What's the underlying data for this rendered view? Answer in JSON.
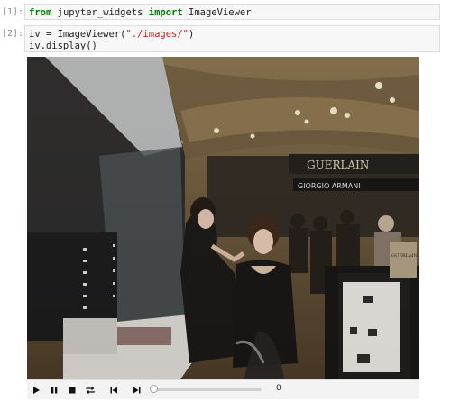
{
  "cells": [
    {
      "prompt": "[1]:",
      "code": {
        "kw1": "from",
        "mod": " jupyter_widgets ",
        "kw2": "import",
        "name": " ImageViewer"
      }
    },
    {
      "prompt": "[2]:",
      "line1": {
        "a": "iv = ImageViewer(",
        "s": "\"./images/\"",
        "b": ")"
      },
      "line2": "iv.display()"
    }
  ],
  "viewer": {
    "image_description_icon": "photo-icon",
    "signs": {
      "guerlain": "GUERLAIN",
      "armani": "GIORGIO ARMANI",
      "bag": "GUERLAIN"
    },
    "controls": {
      "play": "play-icon",
      "pause": "pause-icon",
      "stop": "stop-icon",
      "repeat": "repeat-icon",
      "previous": "skip-previous-icon",
      "next": "skip-next-icon",
      "frame_value": "0",
      "slider_position": 0
    }
  }
}
